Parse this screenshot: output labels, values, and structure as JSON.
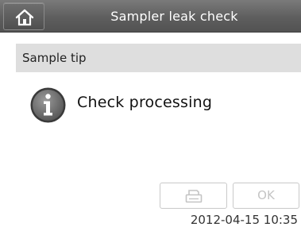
{
  "header": {
    "title": "Sampler leak check",
    "home_icon": "home-icon"
  },
  "status_bar": {
    "label": "Sample tip"
  },
  "message": {
    "icon": "info-icon",
    "text": "Check processing"
  },
  "buttons": {
    "print_icon": "printer-icon",
    "ok_label": "OK",
    "enabled": false
  },
  "footer": {
    "timestamp": "2012-04-15 10:35"
  },
  "colors": {
    "title_bar": "#5e5e5e",
    "status_bar": "#dedede",
    "disabled_text": "#c4c4c4"
  }
}
